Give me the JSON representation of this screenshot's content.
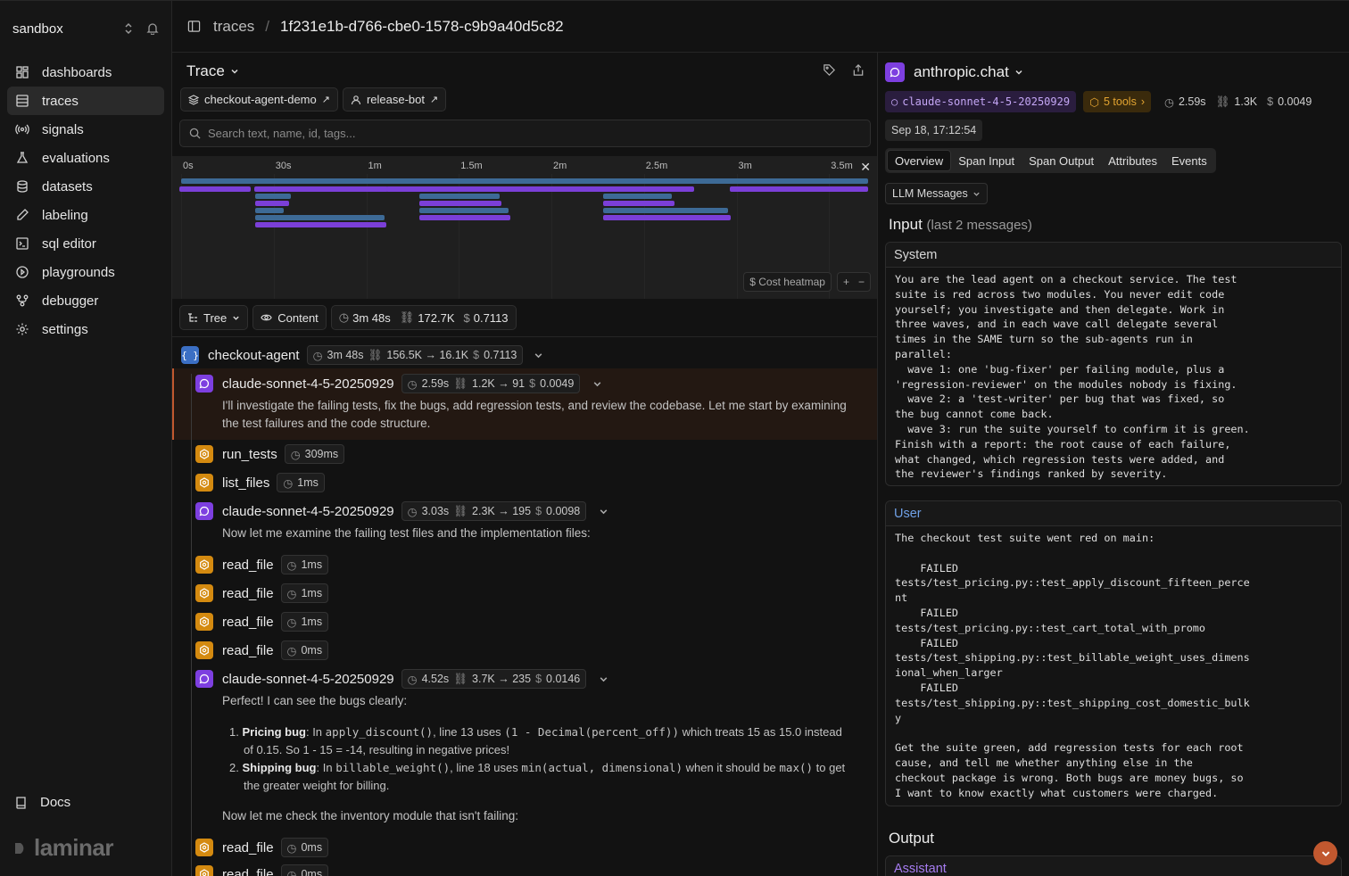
{
  "sidebar": {
    "workspace": "sandbox",
    "items": [
      {
        "label": "dashboards",
        "icon": "dashboard-icon"
      },
      {
        "label": "traces",
        "icon": "traces-icon"
      },
      {
        "label": "signals",
        "icon": "signals-icon"
      },
      {
        "label": "evaluations",
        "icon": "flask-icon"
      },
      {
        "label": "datasets",
        "icon": "database-icon"
      },
      {
        "label": "labeling",
        "icon": "pen-icon"
      },
      {
        "label": "sql editor",
        "icon": "terminal-icon"
      },
      {
        "label": "playgrounds",
        "icon": "play-icon"
      },
      {
        "label": "debugger",
        "icon": "git-icon"
      },
      {
        "label": "settings",
        "icon": "gear-icon"
      }
    ],
    "active": "traces",
    "docs": "Docs",
    "logo": "laminar"
  },
  "header": {
    "crumb": "traces",
    "sep": "/",
    "current": "1f231e1b-d766-cbe0-1578-c9b9a40d5c82"
  },
  "trace": {
    "title": "Trace",
    "chips": [
      "checkout-agent-demo",
      "release-bot"
    ],
    "search_placeholder": "Search text, name, id, tags...",
    "timeline": {
      "ticks": [
        "0s",
        "30s",
        "1m",
        "1.5m",
        "2m",
        "2.5m",
        "3m",
        "3.5m"
      ],
      "cost_heatmap": "$ Cost heatmap",
      "plus": "+",
      "minus": "−"
    },
    "toolbar": {
      "tree": "Tree",
      "content": "Content",
      "duration": "3m 48s",
      "tokens": "172.7K",
      "cost": "0.7113"
    },
    "spans": [
      {
        "name": "checkout-agent",
        "type": "agent",
        "duration": "3m 48s",
        "tokens": "156.5K → 16.1K",
        "cost": "0.7113"
      },
      {
        "name": "claude-sonnet-4-5-20250929",
        "type": "llm",
        "duration": "2.59s",
        "tokens": "1.2K → 91",
        "cost": "0.0049",
        "preview1": "I'll investigate the failing tests, fix the bugs, add regression tests, and review the codebase. Let me start by examining",
        "preview2": "the test failures and the code structure."
      },
      {
        "name": "run_tests",
        "type": "tool",
        "duration": "309ms"
      },
      {
        "name": "list_files",
        "type": "tool",
        "duration": "1ms"
      },
      {
        "name": "claude-sonnet-4-5-20250929",
        "type": "llm",
        "duration": "3.03s",
        "tokens": "2.3K → 195",
        "cost": "0.0098",
        "preview1": "Now let me examine the failing test files and the implementation files:"
      },
      {
        "name": "read_file",
        "type": "tool",
        "duration": "1ms"
      },
      {
        "name": "read_file",
        "type": "tool",
        "duration": "1ms"
      },
      {
        "name": "read_file",
        "type": "tool",
        "duration": "1ms"
      },
      {
        "name": "read_file",
        "type": "tool",
        "duration": "0ms"
      },
      {
        "name": "claude-sonnet-4-5-20250929",
        "type": "llm",
        "duration": "4.52s",
        "tokens": "3.7K → 235",
        "cost": "0.0146",
        "preview1": "Perfect! I can see the bugs clearly:"
      },
      {
        "name": "read_file",
        "type": "tool",
        "duration": "0ms"
      },
      {
        "name": "read_file",
        "type": "tool",
        "duration": "0ms"
      }
    ],
    "list": {
      "item1_bold": "Pricing bug",
      "item1_a": ": In ",
      "item1_code1": "apply_discount()",
      "item1_b": ", line 13 uses ",
      "item1_code2": "(1 - Decimal(percent_off))",
      "item1_c": " which treats 15 as 15.0 instead",
      "item1_d": "of 0.15. So 1 - 15 = -14, resulting in negative prices!",
      "item2_bold": "Shipping bug",
      "item2_a": ": In ",
      "item2_code1": "billable_weight()",
      "item2_b": ", line 18 uses ",
      "item2_code2": "min(actual, dimensional)",
      "item2_c": " when it should be ",
      "item2_code3": "max()",
      "item2_d": " to get",
      "item2_e": "the greater weight for billing.",
      "after": "Now let me check the inventory module that isn't failing:"
    }
  },
  "detail": {
    "title": "anthropic.chat",
    "model": "claude-sonnet-4-5-20250929",
    "tools": "5 tools",
    "duration": "2.59s",
    "tokens": "1.3K",
    "cost": "0.0049",
    "date": "Sep 18, 17:12:54",
    "tabs": [
      "Overview",
      "Span Input",
      "Span Output",
      "Attributes",
      "Events"
    ],
    "active_tab": "Overview",
    "llm_select": "LLM Messages",
    "input_heading": "Input",
    "input_sub": "(last 2 messages)",
    "system_label": "System",
    "system_text": "You are the lead agent on a checkout service. The test\nsuite is red across two modules. You never edit code\nyourself; you investigate and then delegate. Work in\nthree waves, and in each wave call delegate several\ntimes in the SAME turn so the sub-agents run in\nparallel:\n  wave 1: one 'bug-fixer' per failing module, plus a\n'regression-reviewer' on the modules nobody is fixing.\n  wave 2: a 'test-writer' per bug that was fixed, so\nthe bug cannot come back.\n  wave 3: run the suite yourself to confirm it is green.\nFinish with a report: the root cause of each failure,\nwhat changed, which regression tests were added, and\nthe reviewer's findings ranked by severity.",
    "user_label": "User",
    "user_text": "The checkout test suite went red on main:\n\n    FAILED\ntests/test_pricing.py::test_apply_discount_fifteen_perce\nnt\n    FAILED\ntests/test_pricing.py::test_cart_total_with_promo\n    FAILED\ntests/test_shipping.py::test_billable_weight_uses_dimens\nional_when_larger\n    FAILED\ntests/test_shipping.py::test_shipping_cost_domestic_bulk\ny\n\nGet the suite green, add regression tests for each root\ncause, and tell me whether anything else in the\ncheckout package is wrong. Both bugs are money bugs, so\nI want to know exactly what customers were charged.",
    "output_heading": "Output",
    "assistant_label": "Assistant"
  },
  "colors": {
    "agent": "#3b6fc4",
    "llm": "#7d3fe0",
    "tool": "#d48a10",
    "accent": "#c1582f",
    "user": "#6fa0e6",
    "assistant": "#a67cf0"
  }
}
